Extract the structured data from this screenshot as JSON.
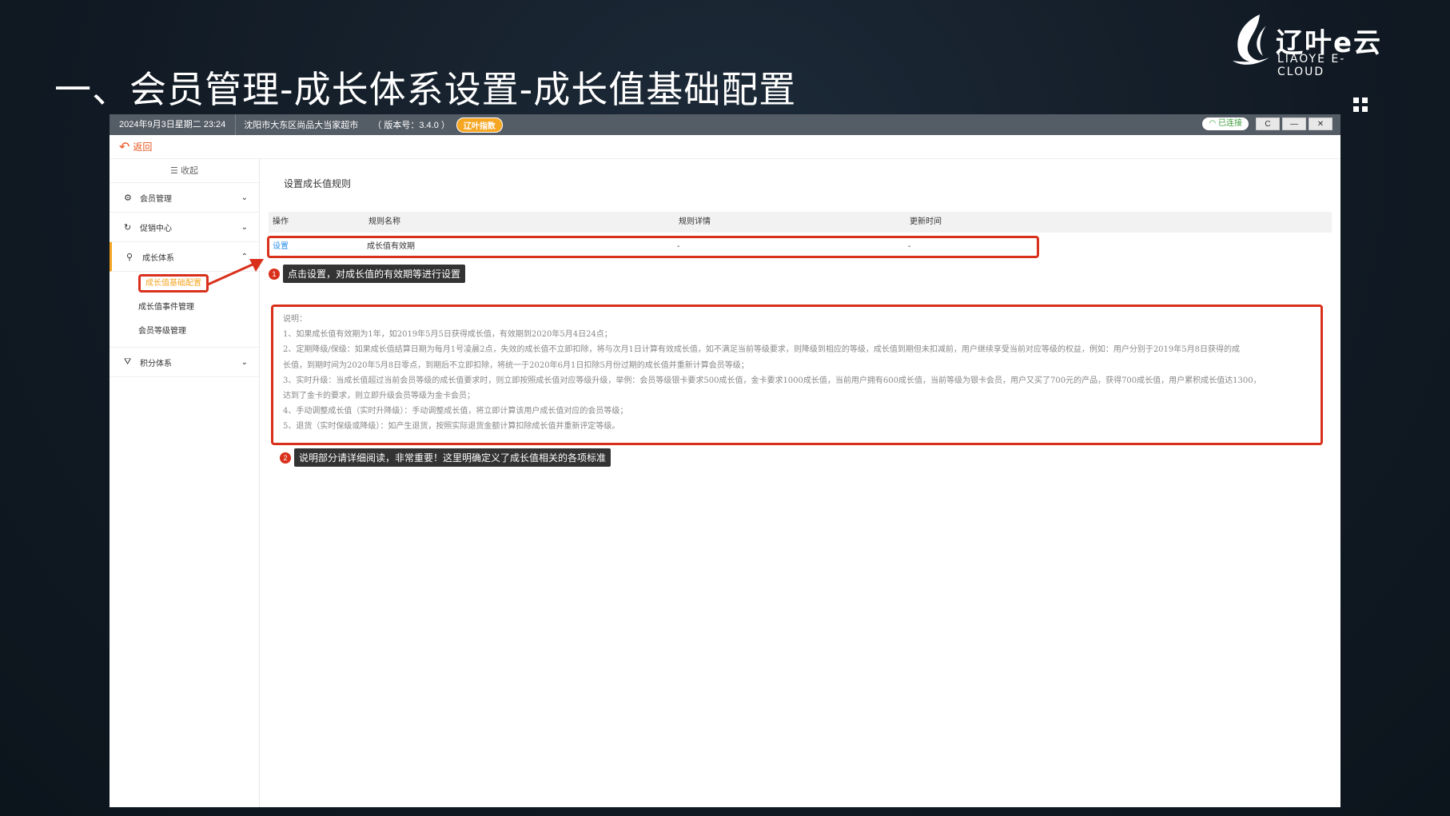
{
  "slide": {
    "title": "一、会员管理-成长体系设置-成长值基础配置"
  },
  "logo": {
    "brand": "辽叶e云",
    "sub": "LIAOYE E-CLOUD"
  },
  "titlebar": {
    "datetime": "2024年9月3日星期二 23:24",
    "store": "沈阳市大东区尚品大当家超市",
    "version": "（ 版本号：3.4.0 ）",
    "badge": "辽叶指数",
    "connection": "已连接",
    "refresh": "C",
    "minimize": "—",
    "close": "✕"
  },
  "backbar": {
    "label": "返回"
  },
  "sidebar": {
    "collapse_label": "☰ 收起",
    "menus": [
      {
        "label": "会员管理",
        "icon": "gear-icon"
      },
      {
        "label": "促销中心",
        "icon": "refresh-icon"
      },
      {
        "label": "成长体系",
        "icon": "growth-icon"
      },
      {
        "label": "积分体系",
        "icon": "filter-icon"
      }
    ],
    "growth_subitems": [
      "成长值基础配置",
      "成长值事件管理",
      "会员等级管理"
    ]
  },
  "main": {
    "section_title": "设置成长值规则",
    "table": {
      "headers": [
        "操作",
        "规则名称",
        "规则详情",
        "更新时间"
      ],
      "row": {
        "action": "设置",
        "name": "成长值有效期",
        "detail": "-",
        "updated": "-"
      }
    },
    "callout1": {
      "num": "1",
      "text": "点击设置，对成长值的有效期等进行设置"
    },
    "notes": [
      "说明：",
      "1、如果成长值有效期为1年，如2019年5月5日获得成长值，有效期到2020年5月4日24点；",
      "2、定期降级/保级：如果成长值结算日期为每月1号凌晨2点，失效的成长值不立即扣除，将与次月1日计算有效成长值，如不满足当前等级要求，则降级到相应的等级，成长值到期但未扣减前，用户继续享受当前对应等级的权益，例如：用户分别于2019年5月8日获得的成",
      "长值，到期时间为2020年5月8日零点，到期后不立即扣除，将统一于2020年6月1日扣除5月份过期的成长值并重新计算会员等级；",
      "3、实时升级：当成长值超过当前会员等级的成长值要求时，则立即按照成长值对应等级升级，举例：会员等级银卡要求500成长值，金卡要求1000成长值，当前用户拥有600成长值，当前等级为银卡会员，用户又买了700元的产品，获得700成长值，用户累积成长值达1300，",
      "达到了金卡的要求，则立即升级会员等级为金卡会员；",
      "4、手动调整成长值（实时升降级）：手动调整成长值，将立即计算该用户成长值对应的会员等级；",
      "5、退货（实时保级或降级）：如产生退货，按照实际退货金额计算扣除成长值并重新评定等级。"
    ],
    "callout2": {
      "num": "2",
      "text": "说明部分请详细阅读，非常重要！这里明确定义了成长值相关的各项标准"
    }
  }
}
